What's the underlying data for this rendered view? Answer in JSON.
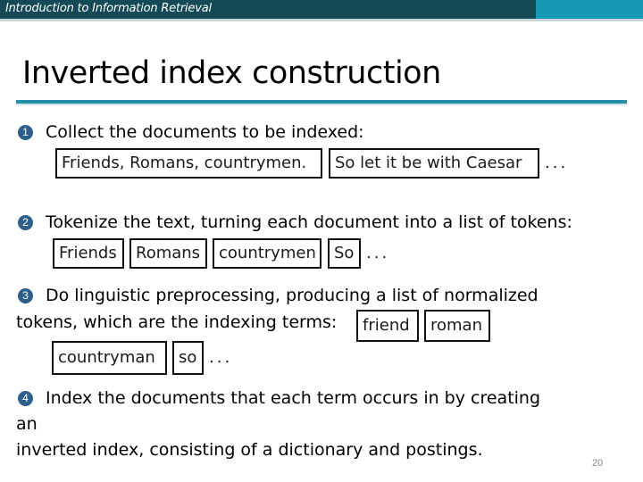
{
  "header": {
    "course_title": "Introduction to Information Retrieval",
    "bar_color": "#134a56",
    "accent_color": "#1798b5"
  },
  "slide": {
    "title": "Inverted index construction",
    "page_number": "20",
    "badge_color": "#2e5f8a",
    "steps": [
      {
        "number": "1",
        "text": "Collect the documents to be indexed:",
        "boxes": [
          "Friends, Romans, countrymen.",
          "So let it be with Caesar"
        ],
        "ellipsis": "..."
      },
      {
        "number": "2",
        "text": "Tokenize the text, turning each document into a list of tokens:",
        "boxes": [
          "Friends",
          "Romans",
          "countrymen",
          "So"
        ],
        "ellipsis": "..."
      },
      {
        "number": "3",
        "text_line1": "Do linguistic preprocessing, producing a list of normalized",
        "text_line2": "tokens, which are the indexing terms:",
        "boxes": [
          "friend",
          "roman",
          "countryman",
          "so"
        ],
        "ellipsis": "..."
      },
      {
        "number": "4",
        "text_line1": "Index the documents that each term occurs in by creating",
        "text_line2": "an",
        "text_line3": "inverted index, consisting of a dictionary and postings."
      }
    ]
  }
}
